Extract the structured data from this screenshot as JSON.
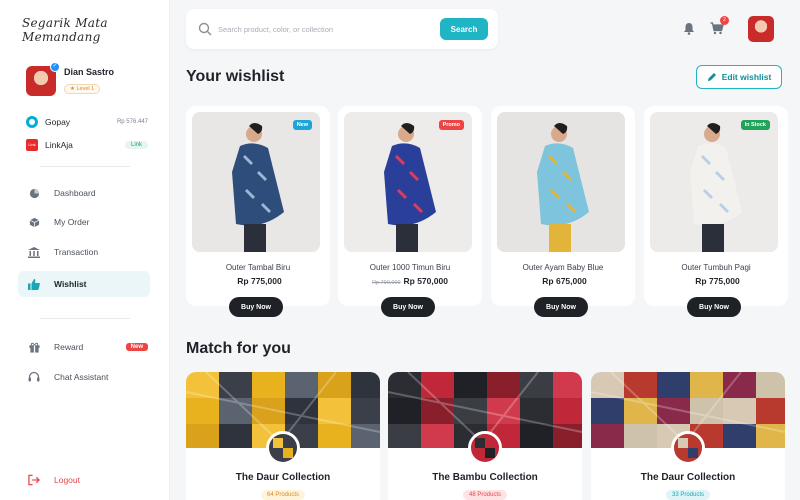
{
  "brand": "Segarik Mata Memandang",
  "user": {
    "name": "Dian Sastro",
    "level": "Level 1"
  },
  "wallets": [
    {
      "name": "Gopay",
      "value": "Rp 576.447"
    },
    {
      "name": "LinkAja",
      "value": "Link",
      "icon_text": "Link Aja"
    }
  ],
  "nav": {
    "dashboard": "Dashboard",
    "my_order": "My Order",
    "transaction": "Transaction",
    "wishlist": "Wishlist",
    "reward": "Reward",
    "reward_badge": "New",
    "chat": "Chat Assistant",
    "logout": "Logout"
  },
  "search": {
    "placeholder": "Search product, color, or collection",
    "button": "Search"
  },
  "header": {
    "cart_count": "2"
  },
  "wishlist": {
    "title": "Your wishlist",
    "edit_label": "Edit wishlist",
    "buy_label": "Buy Now",
    "products": [
      {
        "name": "Outer Tambal Biru",
        "price": "Rp 775,000",
        "old_price": "",
        "tag": "New",
        "tag_color": "#1aa6d6"
      },
      {
        "name": "Outer 1000 Timun Biru",
        "price": "Rp 570,000",
        "old_price": "Rp 790,000",
        "tag": "Promo",
        "tag_color": "#ef4444"
      },
      {
        "name": "Outer Ayam Baby Blue",
        "price": "Rp 675,000",
        "old_price": "",
        "tag": "",
        "tag_color": ""
      },
      {
        "name": "Outer Tumbuh Pagi",
        "price": "Rp 775,000",
        "old_price": "",
        "tag": "In Stock",
        "tag_color": "#22a35a"
      }
    ]
  },
  "match": {
    "title": "Match for you",
    "collections": [
      {
        "name": "The Daur Collection",
        "count": "64 Products",
        "pill_bg": "#fff3da",
        "pill_color": "#d98b2b"
      },
      {
        "name": "The Bambu Collection",
        "count": "48 Products",
        "pill_bg": "#fde3e3",
        "pill_color": "#e5484d"
      },
      {
        "name": "The Daur Collection",
        "count": "33 Products",
        "pill_bg": "#dff4f7",
        "pill_color": "#1aa6b7"
      }
    ]
  },
  "colors": {
    "accent": "#1fb5c4",
    "danger": "#ef4444",
    "dark_button": "#1e2227"
  }
}
